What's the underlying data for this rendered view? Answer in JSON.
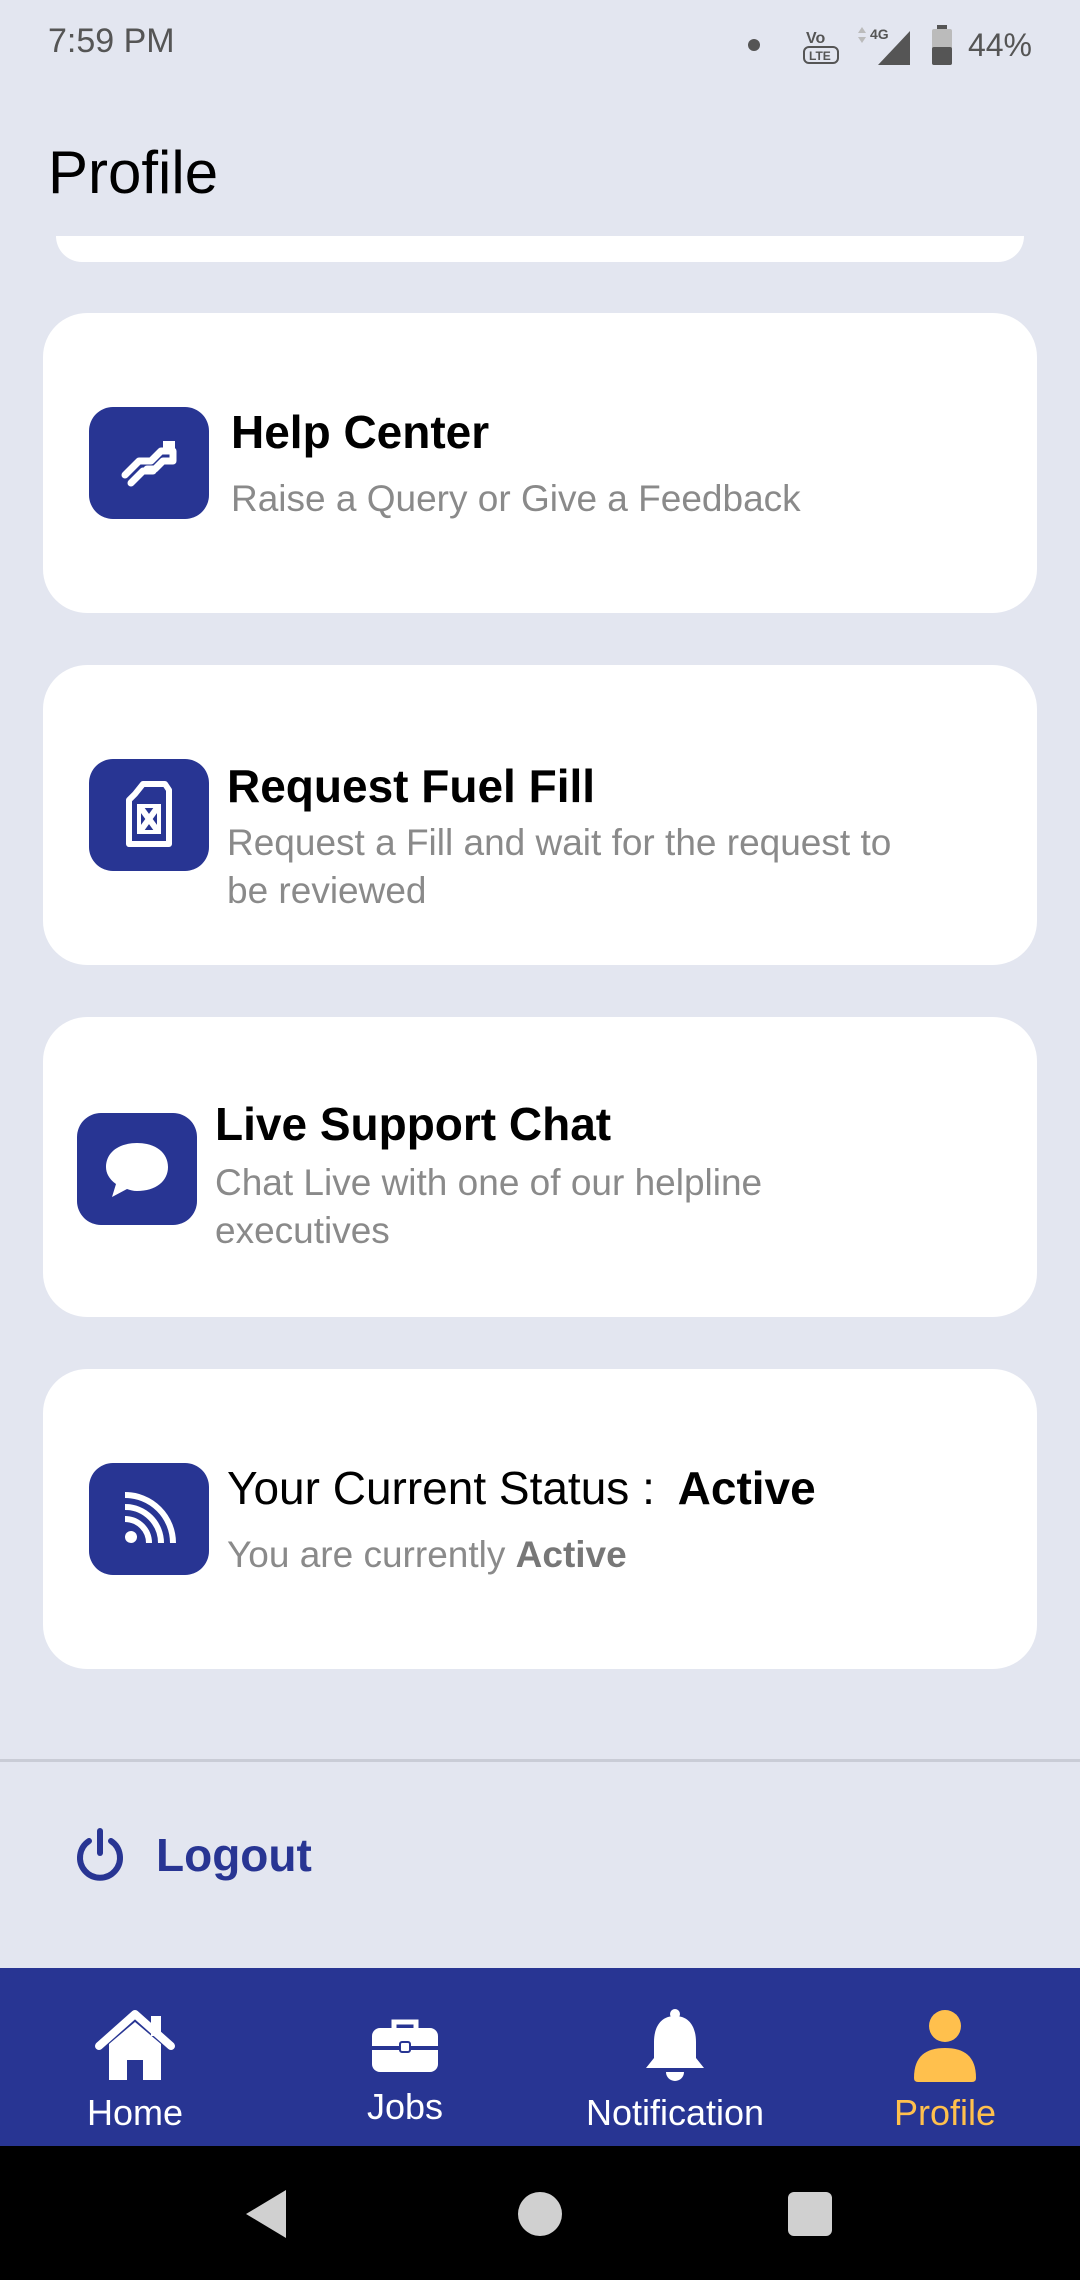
{
  "status_bar": {
    "time": "7:59 PM",
    "network": "4G",
    "volte": "Vo LTE",
    "battery": "44%"
  },
  "header": {
    "title": "Profile"
  },
  "cards": [
    {
      "title": "Help Center",
      "subtitle": "Raise a Query or Give a Feedback",
      "icon": "handshake-icon"
    },
    {
      "title": "Request Fuel Fill",
      "subtitle": "Request a Fill and wait for the request to be reviewed",
      "icon": "fuel-can-icon"
    },
    {
      "title": "Live Support Chat",
      "subtitle": "Chat Live with one of our helpline executives",
      "icon": "chat-bubble-icon"
    }
  ],
  "status_card": {
    "title_prefix": "Your Current Status :",
    "title_value": "Active",
    "sub_prefix": "You are currently",
    "sub_value": "Active",
    "icon": "rss-icon"
  },
  "logout": {
    "label": "Logout",
    "icon": "power-icon"
  },
  "bottom_nav": [
    {
      "label": "Home",
      "icon": "home-icon",
      "active": false
    },
    {
      "label": "Jobs",
      "icon": "briefcase-icon",
      "active": false
    },
    {
      "label": "Notification",
      "icon": "bell-icon",
      "active": false
    },
    {
      "label": "Profile",
      "icon": "person-icon",
      "active": true
    }
  ],
  "colors": {
    "primary": "#283593",
    "accent": "#ffc04d",
    "background": "#e3e6f0"
  }
}
